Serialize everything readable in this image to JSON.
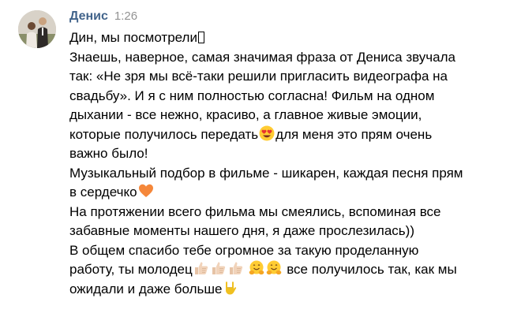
{
  "message": {
    "author": "Денис",
    "time": "1:26",
    "avatar_icon": "user-photo-avatar",
    "lines": {
      "l1": "Дин, мы посмотрели",
      "l2": "Знаешь, наверное, самая значимая фраза от Дениса звучала",
      "l3": "так: «Не зря мы всё-таки решили пригласить видеографа на",
      "l4": "свадьбу». И я с ним полностью согласна! Фильм на одном",
      "l5": "дыхании - все нежно, красиво, а главное живые эмоции,",
      "l6a": "которые получилось передать",
      "l6b": "для меня это прям очень",
      "l7": "важно было!",
      "l8": "Музыкальный подбор в фильме - шикарен, каждая песня прям",
      "l9": "в сердечко",
      "l10": "На протяжении всего фильма мы смеялись, вспоминая все",
      "l11": "забавные моменты нашего дня, я даже прослезилась))",
      "l12": "В общем спасибо тебе огромное за такую проделанную",
      "l13a": "работу, ты молодец",
      "l13b": "все получилось так, как мы",
      "l14": "ожидали и даже больше"
    },
    "emojis": [
      "heart-eyes-emoji",
      "orange-heart-emoji",
      "thumbs-up-emoji",
      "hugging-face-emoji",
      "rock-on-hand-emoji"
    ]
  }
}
